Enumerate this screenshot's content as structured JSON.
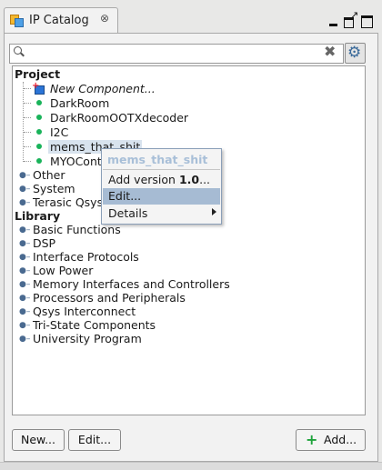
{
  "window": {
    "tab_title": "IP Catalog",
    "tab_close": "⊗",
    "controls": [
      "minimize-icon",
      "restore-icon",
      "maximize-icon"
    ]
  },
  "search": {
    "value": "",
    "placeholder": "",
    "clear_icon": "✖",
    "settings_icon": "⚙"
  },
  "tree": {
    "project_title": "Project",
    "project_items": [
      {
        "label": "New Component...",
        "italic": true,
        "icon": "new-component-icon"
      },
      {
        "label": "DarkRoom",
        "icon": "green-dot-icon"
      },
      {
        "label": "DarkRoomOOTXdecoder",
        "icon": "green-dot-icon"
      },
      {
        "label": "I2C",
        "icon": "green-dot-icon"
      },
      {
        "label": "mems_that_shit",
        "icon": "green-dot-icon",
        "selected": true
      },
      {
        "label": "MYOCont",
        "icon": "green-dot-icon"
      }
    ],
    "project_groups": [
      "Other",
      "System",
      "Terasic Qsys"
    ],
    "library_title": "Library",
    "library_groups": [
      "Basic Functions",
      "DSP",
      "Interface Protocols",
      "Low Power",
      "Memory Interfaces and Controllers",
      "Processors and Peripherals",
      "Qsys Interconnect",
      "Tri-State Components",
      "University Program"
    ]
  },
  "context_menu": {
    "title": "mems_that_shit",
    "items": [
      {
        "label": "Add version ",
        "bold_suffix": "1.0",
        "suffix": "..."
      },
      {
        "label": "Edit...",
        "highlighted": true
      },
      {
        "label": "Details",
        "submenu": true
      }
    ]
  },
  "buttons": {
    "new_label": "New...",
    "edit_label": "Edit...",
    "add_label": "Add...",
    "add_icon": "+"
  },
  "colors": {
    "selection": "#d8e3ee",
    "menu_highlight": "#a6bbd3",
    "status_dot": "#19b35a",
    "add_icon": "#1ea33b"
  }
}
